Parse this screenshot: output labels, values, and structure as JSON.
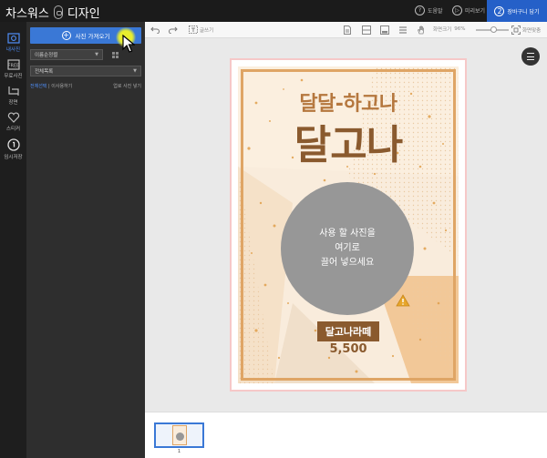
{
  "app": {
    "brand_prefix": "차스워스",
    "brand_suffix": "디자인"
  },
  "header": {
    "help_label": "도움말",
    "preview_label": "미리보기",
    "preview_icon": "play-circle-icon",
    "cart_label": "장바구니 담기",
    "cart_step": "2",
    "accent_color": "#2560c8"
  },
  "leftnav": {
    "items": [
      {
        "label": "내사진",
        "icon": "photo-icon"
      },
      {
        "label": "무료사진",
        "icon": "free-photo-icon"
      },
      {
        "label": "장면",
        "icon": "scene-icon"
      },
      {
        "label": "스티커",
        "icon": "heart-icon"
      },
      {
        "label": "임시저장",
        "icon": "save-icon"
      }
    ]
  },
  "panel": {
    "add_photo_label": "사진 가져오기",
    "sort_select": "이름순정렬",
    "folder_select": "전체목록",
    "link_left_a": "전체선택",
    "link_left_b": "이사용하기",
    "link_right": "업로 사진 넣기"
  },
  "toolbar": {
    "undo_icon": "undo-icon",
    "redo_icon": "redo-icon",
    "text_label": "글쓰기",
    "zoom_label": "화면크기",
    "zoom_value": "96%",
    "zoom_level": 0.55,
    "fit_label": "화면맞춤"
  },
  "design": {
    "subtitle": "달달-하고나",
    "title": "달고나",
    "photo_line1": "사용 할 사진을",
    "photo_line2": "여기로",
    "photo_line3": "끌어 넣으세요",
    "price_label": "달고나라떼",
    "price": "5,500",
    "bg_color": "#f9ecdc",
    "frame_color": "#dfa565",
    "text_color": "#8a5a2e"
  },
  "thumbnails": {
    "page_number": "1"
  }
}
